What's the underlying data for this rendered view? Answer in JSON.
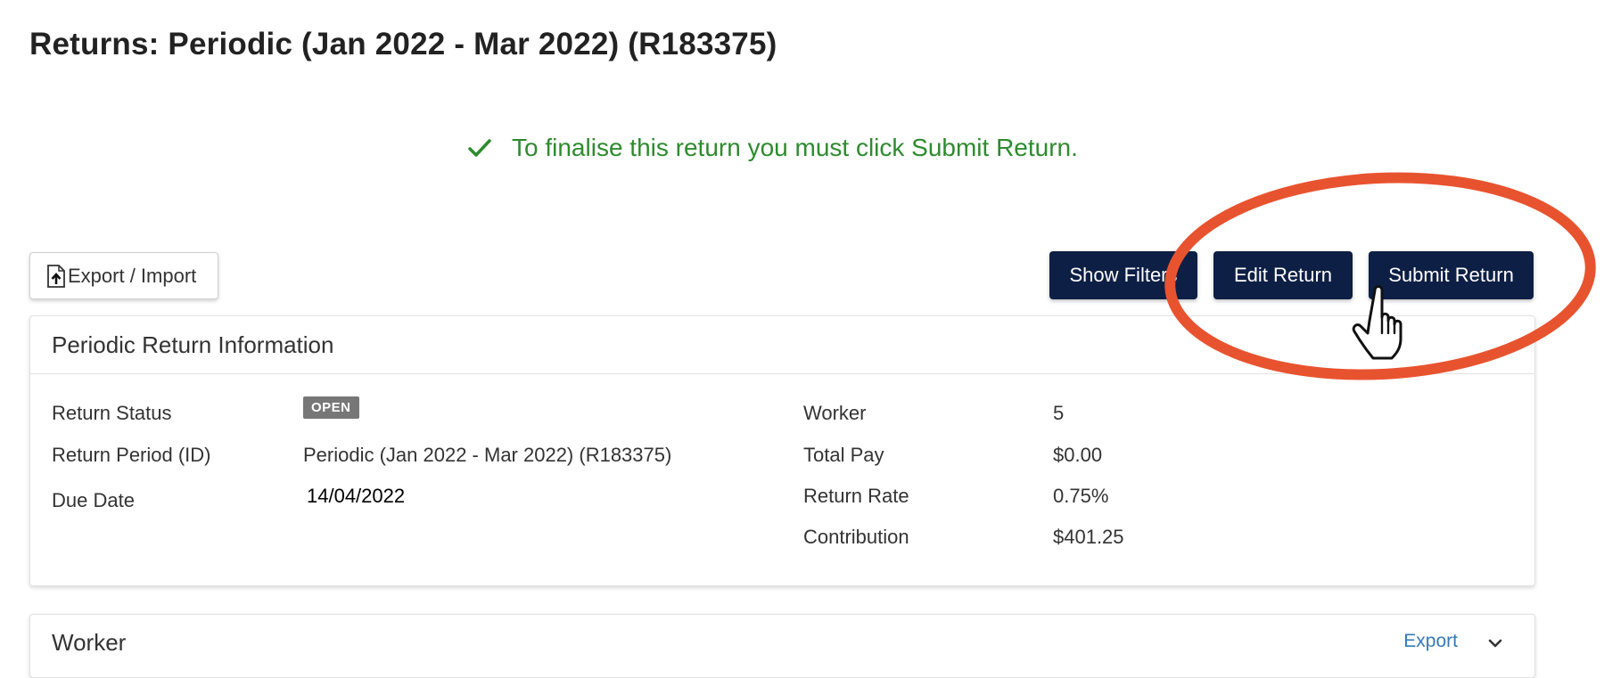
{
  "page": {
    "title": "Returns: Periodic (Jan 2022 - Mar 2022) (R183375)"
  },
  "notice": {
    "message": "To finalise this return you must click Submit Return.",
    "icon": "check-icon",
    "color": "#2e8b2e"
  },
  "toolbar": {
    "export_import_label": "Export / Import",
    "export_import_icon": "file-upload-icon",
    "show_filters_label": "Show Filters",
    "edit_return_label": "Edit Return",
    "submit_return_label": "Submit Return",
    "accent_color": "#0e1f45"
  },
  "info_card": {
    "title": "Periodic Return Information",
    "left": [
      {
        "label": "Return Status",
        "value": "OPEN"
      },
      {
        "label": "Return Period (ID)",
        "value": "Periodic (Jan 2022 - Mar 2022) (R183375)"
      },
      {
        "label": "Due Date",
        "value": "14/04/2022"
      }
    ],
    "right": [
      {
        "label": "Worker",
        "value": "5"
      },
      {
        "label": "Total Pay",
        "value": "$0.00"
      },
      {
        "label": "Return Rate",
        "value": "0.75%"
      },
      {
        "label": "Contribution",
        "value": "$401.25"
      }
    ]
  },
  "worker_card": {
    "title": "Worker",
    "export_label": "Export",
    "chevron_icon": "chevron-down-icon"
  },
  "annotation": {
    "ring_color": "#e8532f",
    "cursor_icon": "hand-pointer-icon"
  }
}
